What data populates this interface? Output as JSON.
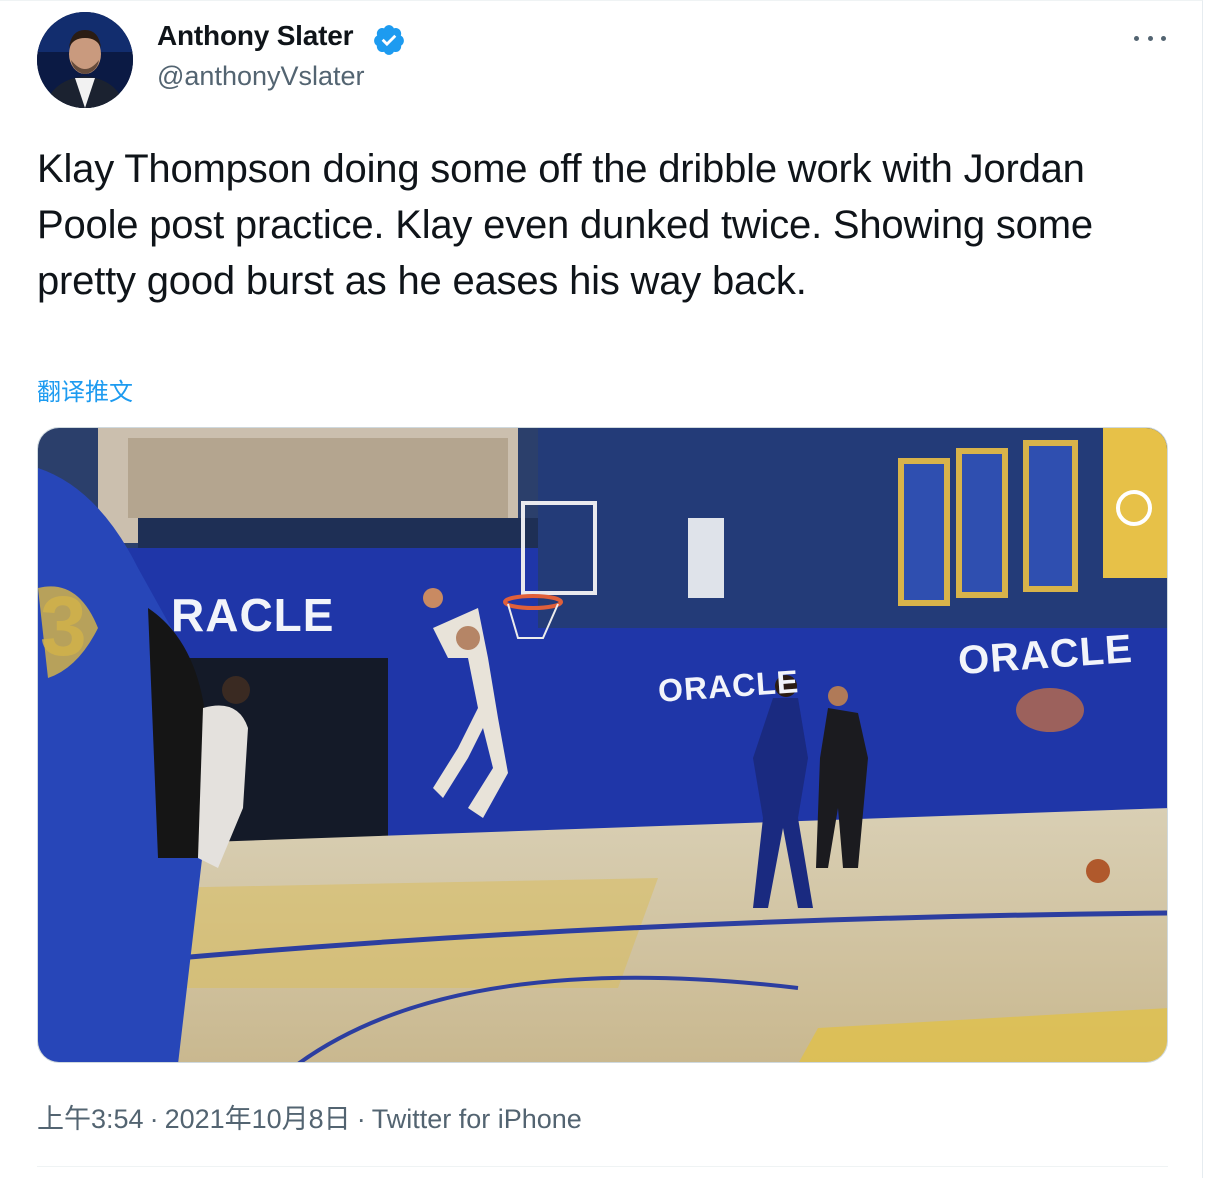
{
  "author": {
    "name": "Anthony Slater",
    "handle": "@anthonyVslater"
  },
  "tweet": {
    "text": "Klay Thompson doing some off the dribble work with Jordan Poole post practice. Klay even dunked twice. Showing some pretty good burst as he eases his way back.",
    "translate_label": "翻译推文"
  },
  "media": {
    "signs": [
      "RACLE",
      "ORACLE",
      "ORACLE"
    ],
    "jersey_number": "3"
  },
  "meta": {
    "time": "上午3:54",
    "date": "2021年10月8日",
    "source": "Twitter for iPhone",
    "separator": "·"
  },
  "colors": {
    "link": "#1d9bf0",
    "secondary_text": "#536471",
    "verified_badge": "#1d9bf0"
  },
  "icons": {
    "verified": "verified-badge-icon",
    "more": "more-options-icon"
  }
}
